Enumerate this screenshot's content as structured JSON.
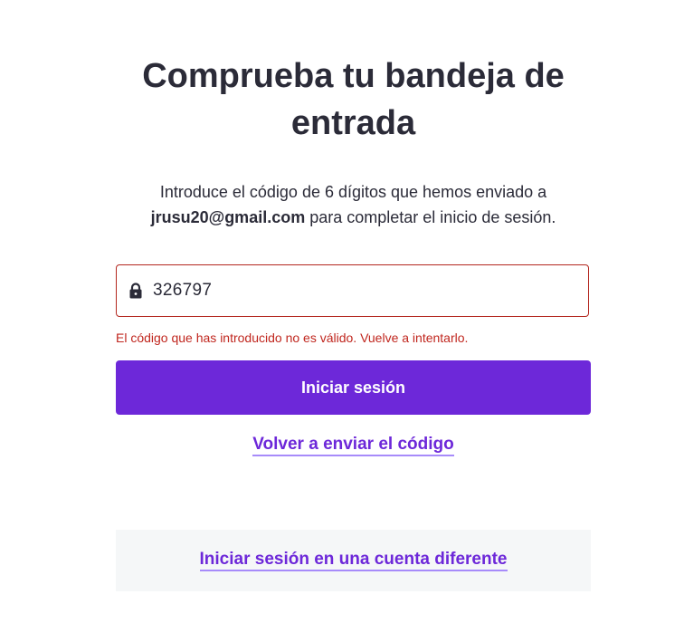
{
  "heading": {
    "title": "Comprueba tu bandeja de entrada"
  },
  "instructions": {
    "line_prefix": "Introduce el código de 6 dígitos que hemos enviado a",
    "email": "jrusu20@gmail.com",
    "line_suffix": "para completar el inicio de sesión."
  },
  "code_field": {
    "value": "326797",
    "icon": "lock-icon"
  },
  "error": {
    "message": "El código que has introducido no es válido. Vuelve a intentarlo."
  },
  "actions": {
    "signin_label": "Iniciar sesión",
    "resend_label": "Volver a enviar el código",
    "other_account_label": "Iniciar sesión en una cuenta diferente"
  },
  "colors": {
    "primary": "#6d28d9",
    "error": "#c0261e",
    "text": "#2b2b38",
    "footer_bg": "#f5f7f8"
  }
}
